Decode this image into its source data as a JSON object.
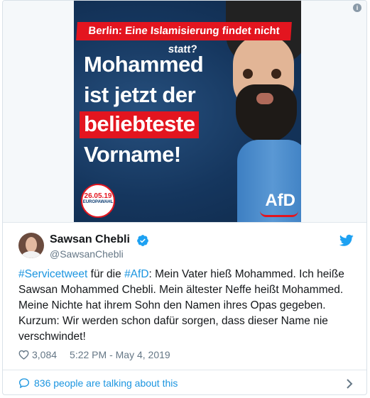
{
  "poster": {
    "banner": "Berlin: Eine Islamisierung findet nicht statt?",
    "line1": "Mohammed",
    "line2": "ist jetzt der",
    "line3": "beliebteste",
    "line4": "Vorname!",
    "badge_date": "26.05.19",
    "badge_word": "EUROPAWAHL",
    "logo": "AfD"
  },
  "media": {
    "info_icon": "i"
  },
  "author": {
    "name": "Sawsan Chebli",
    "handle": "@SawsanChebli"
  },
  "tweet": {
    "part1": "#Servicetweet",
    "part2": " für die ",
    "part3": "#AfD",
    "part4": ": Mein Vater hieß Mohammed. Ich heiße Sawsan Mohammed Chebli. Mein ältester Neffe heißt Mohammed. Meine Nichte hat ihrem Sohn den Namen ihres Opas gegeben. Kurzum: Wir werden schon dafür sorgen, dass dieser Name nie verschwindet!"
  },
  "meta": {
    "likes": "3,084",
    "timestamp": "5:22 PM - May 4, 2019"
  },
  "footer": {
    "talking": "836 people are talking about this"
  },
  "colors": {
    "link": "#1b95e0",
    "afd_red": "#e3151f",
    "poster_blue": "#15365e"
  },
  "icons": [
    "info-icon",
    "verified-icon",
    "twitter-bird-icon",
    "heart-icon",
    "speech-bubble-icon",
    "chevron-right-icon"
  ]
}
